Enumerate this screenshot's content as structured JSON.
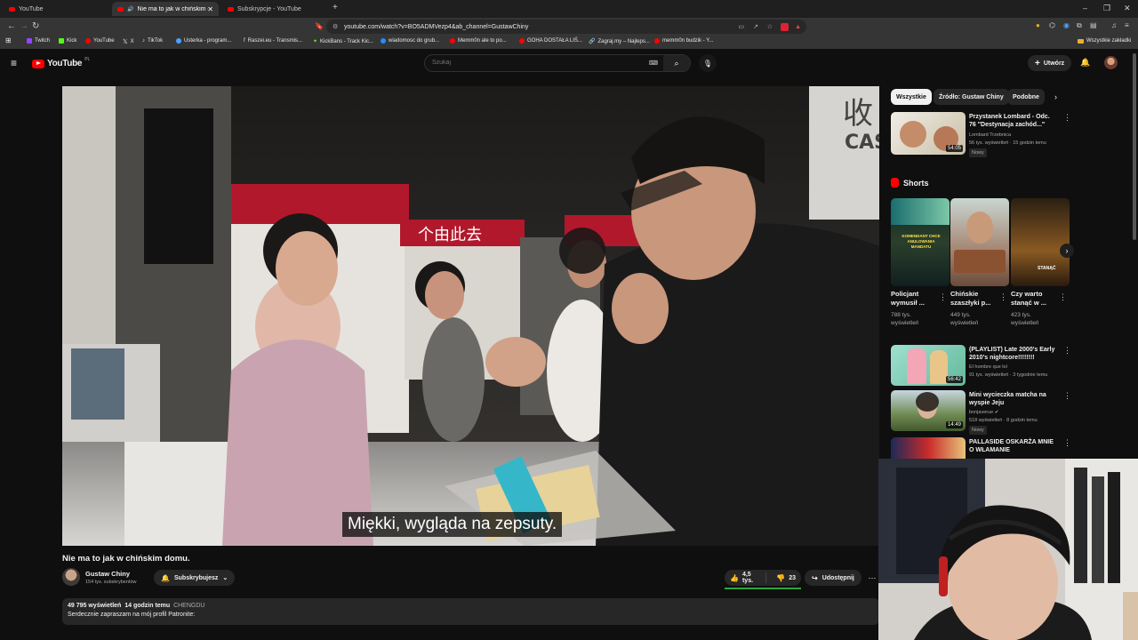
{
  "browser": {
    "tabs": [
      {
        "title": "YouTube",
        "active": false
      },
      {
        "title": "Nie ma to jak w chińskim do…",
        "active": true
      },
      {
        "title": "Subskrypcje - YouTube",
        "active": false
      }
    ],
    "url": "youtube.com/watch?v=BO5ADMVezp4&ab_channel=GustawChiny",
    "bookmarks": [
      "Twitch",
      "Kick",
      "YouTube",
      "X",
      "TikTok",
      "Usterka - program...",
      "Raszei.eu - Transmis...",
      "KickBans - Track Kic...",
      "wiadomosc do grub...",
      "Memm0n ale to po...",
      "GOHA DOSTAŁA LIŚ...",
      "Zagraj.my – Najleps...",
      "memm0n budzik - Y..."
    ],
    "all_bookmarks": "Wszystkie zakładki"
  },
  "youtube": {
    "logo": "YouTube",
    "logo_region": "PL",
    "search_placeholder": "Szukaj",
    "create_label": "Utwórz"
  },
  "video": {
    "subtitle": "Miękki, wygląda na zepsuty.",
    "title": "Nie ma to jak w chińskim domu.",
    "channel": "Gustaw Chiny",
    "subscribers": "154 tys. subskrybentów",
    "subscribe_label": "Subskrybujesz",
    "likes": "4,5 tys.",
    "dislikes": "23",
    "share_label": "Udostępnij",
    "views": "49 795 wyświetleń",
    "date": "14 godzin temu",
    "location": "CHENGDU",
    "description": "Serdecznie zapraszam na mój profil Patronite:",
    "overlay_sign": "收",
    "overlay_sign2": "CAS",
    "store_sign": "个由此去"
  },
  "sidebar": {
    "chips": [
      "Wszystkie",
      "Źródło: Gustaw Chiny",
      "Podobne"
    ],
    "recs_top": [
      {
        "title": "Przystanek Lombard - Odc. 76 \"Destynacja zachód...\"",
        "channel": "Lombard Trzebnica",
        "meta": "56 tys. wyświetleń · 15 godzin temu",
        "badge": "Nowy",
        "duration": "54:05"
      }
    ],
    "shorts_label": "Shorts",
    "shorts": [
      {
        "title": "Policjant wymusił ...",
        "views": "788 tys. wyświetleń",
        "overlay": "KOMENDANT CHCE ANULOWANIA MANDATU"
      },
      {
        "title": "Chińskie szaszłyki p...",
        "views": "449 tys. wyświetleń",
        "overlay": ""
      },
      {
        "title": "Czy warto stanąć w ...",
        "views": "423 tys. wyświetleń",
        "overlay": "STANĄĆ"
      }
    ],
    "recs_bottom": [
      {
        "title": "(PLAYLIST) Late 2000's Early 2010's nightcore!!!!!!!!",
        "channel": "El hombre que lol",
        "meta": "91 tys. wyświetleń · 3 tygodnie temu",
        "badge": "",
        "duration": "56:42"
      },
      {
        "title": "Mini wycieczka matcha na wyspie Jeju",
        "channel": "bonjaveruе",
        "meta": "518 wyświetleń · 8 godzin temu",
        "badge": "Nowy",
        "duration": "14:49"
      },
      {
        "title": "PALLASIDE OSKARŻA MNIE O WŁAMANIE",
        "channel": "",
        "meta": "",
        "badge": "",
        "duration": ""
      }
    ]
  },
  "colors": {
    "bg": "#0f0f0f",
    "accent_red": "#ff0000",
    "chip_active": "#f1f1f1",
    "chip": "#272727"
  }
}
